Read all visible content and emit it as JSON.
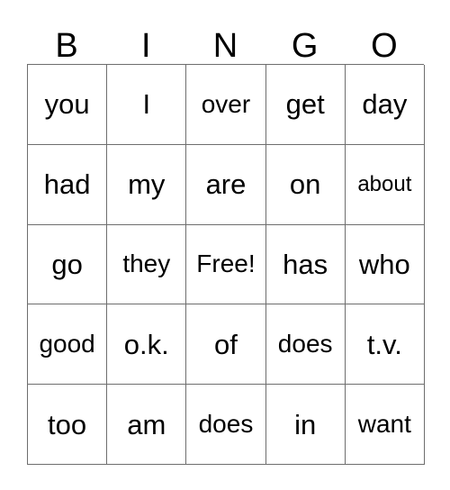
{
  "card": {
    "header_letters": [
      "B",
      "I",
      "N",
      "G",
      "O"
    ],
    "rows": [
      [
        {
          "text": "you",
          "size": "normal"
        },
        {
          "text": "I",
          "size": "normal"
        },
        {
          "text": "over",
          "size": "md"
        },
        {
          "text": "get",
          "size": "normal"
        },
        {
          "text": "day",
          "size": "normal"
        }
      ],
      [
        {
          "text": "had",
          "size": "normal"
        },
        {
          "text": "my",
          "size": "normal"
        },
        {
          "text": "are",
          "size": "normal"
        },
        {
          "text": "on",
          "size": "normal"
        },
        {
          "text": "about",
          "size": "sm"
        }
      ],
      [
        {
          "text": "go",
          "size": "normal"
        },
        {
          "text": "they",
          "size": "md"
        },
        {
          "text": "Free!",
          "size": "md"
        },
        {
          "text": "has",
          "size": "normal"
        },
        {
          "text": "who",
          "size": "normal"
        }
      ],
      [
        {
          "text": "good",
          "size": "md"
        },
        {
          "text": "o.k.",
          "size": "normal"
        },
        {
          "text": "of",
          "size": "normal"
        },
        {
          "text": "does",
          "size": "md"
        },
        {
          "text": "t.v.",
          "size": "normal"
        }
      ],
      [
        {
          "text": "too",
          "size": "normal"
        },
        {
          "text": "am",
          "size": "normal"
        },
        {
          "text": "does",
          "size": "md"
        },
        {
          "text": "in",
          "size": "normal"
        },
        {
          "text": "want",
          "size": "md"
        }
      ]
    ],
    "free_space_label": "Free!",
    "colors": {
      "background": "#ffffff",
      "border": "#6e6e6e",
      "text": "#000000"
    }
  }
}
